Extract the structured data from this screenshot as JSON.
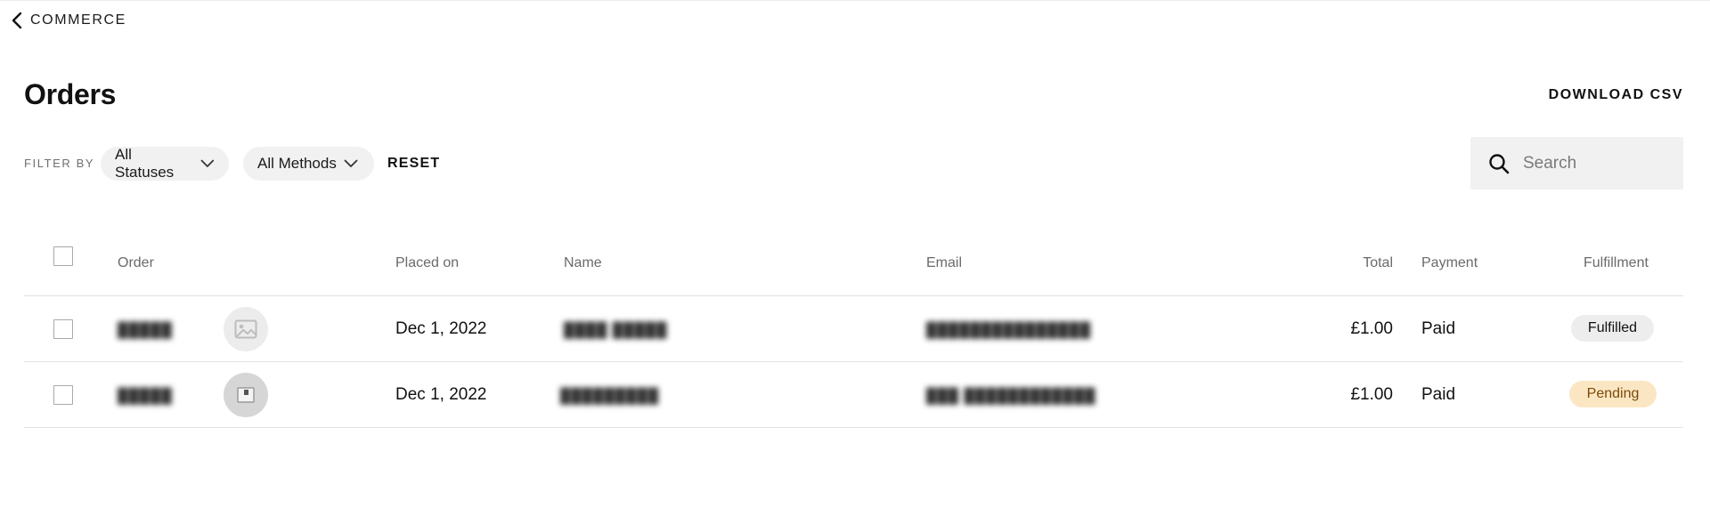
{
  "nav": {
    "back_label": "COMMERCE"
  },
  "page": {
    "title": "Orders",
    "download_label": "DOWNLOAD CSV"
  },
  "filters": {
    "label": "FILTER BY",
    "status_selected": "All Statuses",
    "method_selected": "All Methods",
    "reset_label": "RESET"
  },
  "search": {
    "placeholder": "Search",
    "value": ""
  },
  "table": {
    "columns": {
      "order": "Order",
      "placed_on": "Placed on",
      "name": "Name",
      "email": "Email",
      "total": "Total",
      "payment": "Payment",
      "fulfillment": "Fulfillment"
    },
    "rows": [
      {
        "order": "█████",
        "placed_on": "Dec 1, 2022",
        "name": "████ █████",
        "email": "███████████████",
        "total": "£1.00",
        "payment": "Paid",
        "fulfillment": "Fulfilled",
        "thumb_icon": "image-placeholder-icon"
      },
      {
        "order": "█████",
        "placed_on": "Dec 1, 2022",
        "name": "█████████",
        "email": "███ ████████████",
        "total": "£1.00",
        "payment": "Paid",
        "fulfillment": "Pending",
        "thumb_icon": "product-thumbnail-icon"
      }
    ]
  },
  "colors": {
    "pending_bg": "#fbe6c4",
    "pending_text": "#7a4a06",
    "fulfilled_bg": "#ededed",
    "pill_bg": "#f1f1f1"
  }
}
